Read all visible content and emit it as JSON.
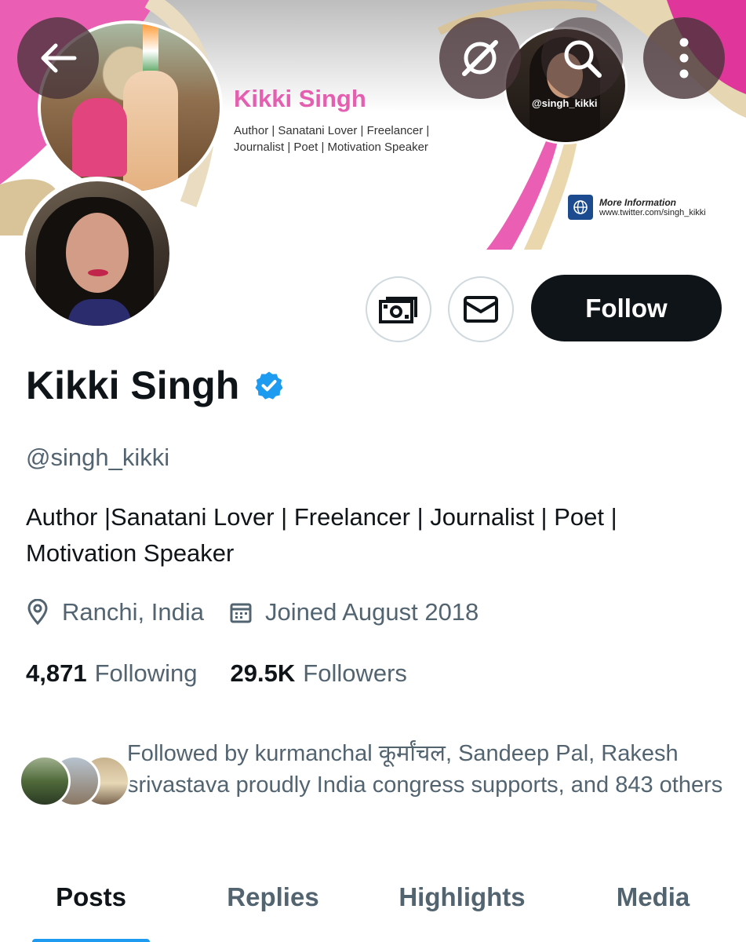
{
  "banner": {
    "name": "Kikki Singh",
    "tagline_line1": "Author | Sanatani Lover | Freelancer |",
    "tagline_line2": "Journalist | Poet | Motivation Speaker",
    "photo_handle": "@singh_kikki",
    "more_info_title": "More Information",
    "more_info_url": "www.twitter.com/singh_kikki",
    "colors": {
      "pink": "#ea5fb4",
      "gold": "#d9c49a",
      "magenta": "#e0369b"
    }
  },
  "header_buttons": {
    "back": "back-arrow-icon",
    "grok": "grok-icon",
    "search": "search-icon",
    "menu": "more-vertical-icon"
  },
  "actions": {
    "tip_icon": "money-icon",
    "message_icon": "envelope-icon",
    "follow_label": "Follow"
  },
  "profile": {
    "display_name": "Kikki Singh",
    "verified": true,
    "handle": "@singh_kikki",
    "bio_line1": "Author |Sanatani Lover | Freelancer | Journalist | Poet |",
    "bio_line2": "Motivation Speaker",
    "location": "Ranchi, India",
    "joined": "Joined August 2018",
    "following_count": "4,871",
    "following_label": "Following",
    "followers_count": "29.5K",
    "followers_label": "Followers",
    "followed_by": "Followed by kurmanchal कूर्मांचल, Sandeep Pal, Rakesh srivastava proudly India congress supports, and 843 others"
  },
  "tabs": [
    {
      "label": "Posts",
      "active": true
    },
    {
      "label": "Replies",
      "active": false
    },
    {
      "label": "Highlights",
      "active": false
    },
    {
      "label": "Media",
      "active": false
    }
  ],
  "theme": {
    "accent": "#1d9bf0",
    "text": "#0f1419",
    "muted": "#536471",
    "border": "#cfd9de"
  }
}
